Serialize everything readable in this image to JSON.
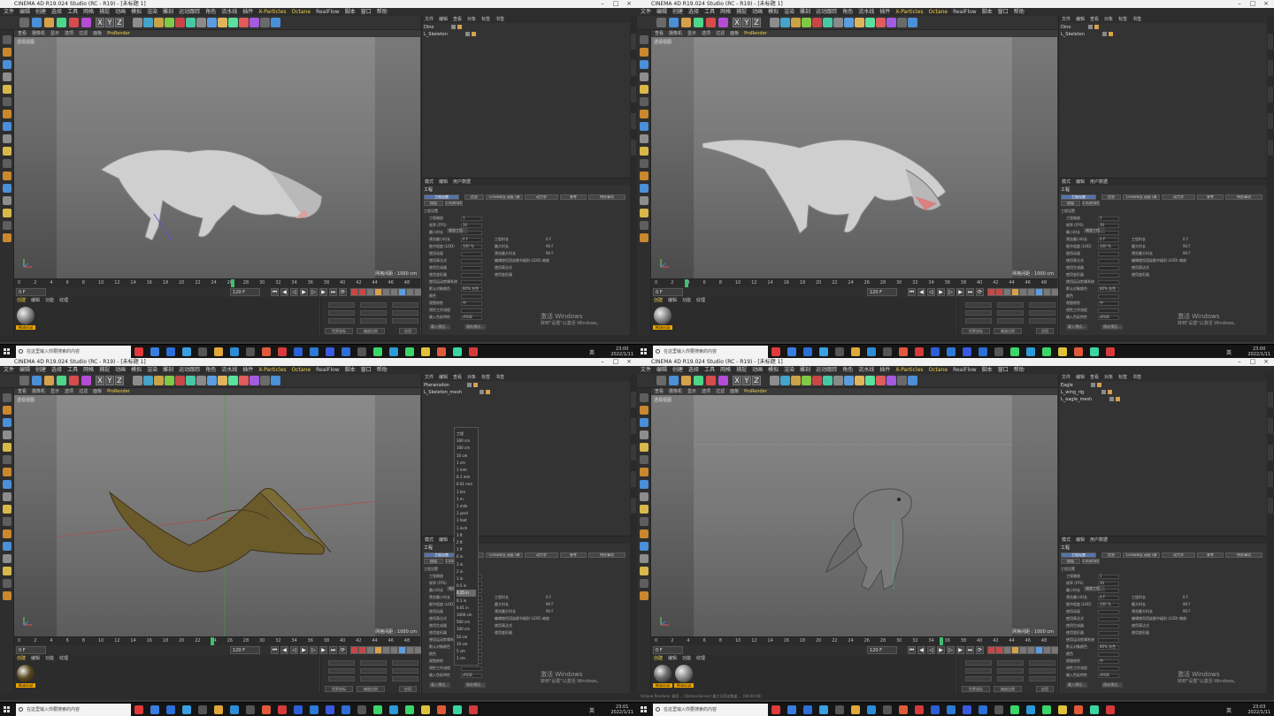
{
  "app": {
    "title": "CINEMA 4D R19.024 Studio (RC - R19) - [未标题 1]",
    "menu": [
      "文件",
      "编辑",
      "创建",
      "选择",
      "工具",
      "网格",
      "捕捉",
      "动画",
      "模拟",
      "渲染",
      "雕刻",
      "运动跟踪",
      "角色",
      "流水线",
      "插件",
      "X-Particles",
      "Octane",
      "RealFlow",
      "脚本",
      "窗口",
      "帮助"
    ],
    "layout_label": "界面:",
    "layout_value": "启动"
  },
  "viewport": {
    "menu": [
      "查看",
      "摄像机",
      "显示",
      "选项",
      "过滤",
      "面板",
      "ProRender"
    ],
    "camera_label": "透视视图",
    "grid_label": "网格间距 : 1000 cm"
  },
  "timeline": {
    "ticks": [
      "0",
      "2",
      "4",
      "6",
      "8",
      "10",
      "12",
      "14",
      "16",
      "18",
      "20",
      "22",
      "24",
      "26",
      "28",
      "30",
      "32",
      "34",
      "36",
      "38",
      "40",
      "42",
      "44",
      "46",
      "48"
    ],
    "start_field": "0 F",
    "end_field": "120 F",
    "frame_field": "0 F"
  },
  "material_panel": {
    "menu": [
      "创建",
      "编辑",
      "功能",
      "纹理"
    ],
    "material_name": "Material"
  },
  "coords_panel": {
    "buttons": [
      "世界坐标",
      "缩放比例",
      "应用"
    ]
  },
  "object_manager": {
    "menu": [
      "文件",
      "编辑",
      "查看",
      "对象",
      "标签",
      "书签"
    ],
    "quads": [
      {
        "rows": [
          "Dino",
          "L_Skeleton"
        ]
      },
      {
        "rows": [
          "Dino",
          "L_Skeleton"
        ]
      },
      {
        "rows": [
          "Pteranodon",
          "L_Skeleton_mesh"
        ]
      },
      {
        "rows": [
          "Eagle",
          "L_wing_rig",
          "L_eagle_mesh"
        ]
      }
    ]
  },
  "attribute_manager": {
    "menu": [
      "模式",
      "编辑",
      "用户数据"
    ],
    "title": "工程",
    "tabs": [
      "工程设置",
      "信息",
      "Cineware 动画 (调用)",
      "动力学",
      "参考",
      "待办事项",
      "插值",
      "Cinema4D 传出"
    ],
    "section": "工程设置",
    "rows": [
      {
        "label": "工程缩放",
        "value": "1"
      },
      {
        "label": "帧率 (FPS)",
        "value": "30"
      },
      {
        "label": "最小时长",
        "value": "0 F"
      },
      {
        "label": "预览最小时长",
        "value": "0 F"
      },
      {
        "label": "细节程度 (LOD)",
        "value": "100 %"
      },
      {
        "label": "使用动画",
        "value": ""
      },
      {
        "label": "使用表达式",
        "value": ""
      },
      {
        "label": "使用生成器",
        "value": ""
      },
      {
        "label": "使用变形器",
        "value": ""
      },
      {
        "label": "使用运动剪辑系统",
        "value": ""
      },
      {
        "label": "默认对象颜色",
        "value": "80% 灰色"
      },
      {
        "label": "颜色",
        "value": ""
      },
      {
        "label": "视图修剪",
        "value": "中"
      },
      {
        "label": "线性工作流程",
        "value": ""
      },
      {
        "label": "输入色彩特性",
        "value": "sRGB"
      }
    ],
    "right_rows": [
      {
        "label": "工程时长",
        "value": "0 F"
      },
      {
        "label": "最大时长",
        "value": "90 F"
      },
      {
        "label": "预览最大时长",
        "value": "90 F"
      },
      {
        "label": "编辑使用渲染细节级别 (LOD) 缩放",
        "value": ""
      },
      {
        "label": "使用表达式",
        "value": ""
      },
      {
        "label": "使用变形器",
        "value": ""
      }
    ],
    "buttons": [
      "缩放工程...",
      "载入预设...",
      "保存预设..."
    ]
  },
  "watermark": {
    "line1": "激活 Windows",
    "line2": "转到\"设置\"以激活 Windows。"
  },
  "taskbar": {
    "search_placeholder": "在这里输入你要搜索的内容",
    "ime": "英",
    "clock": [
      {
        "time": "23:00",
        "date": "2022/1/11"
      },
      {
        "time": "23:00",
        "date": "2022/1/11"
      },
      {
        "time": "23:01",
        "date": "2022/1/11"
      },
      {
        "time": "23:03",
        "date": "2022/1/11"
      }
    ]
  },
  "status": {
    "text": "Octane Renderer 调用 ... [OctaneServer] 最大可用化数量 ... (00:00:00)"
  },
  "dropdown": {
    "items": [
      "工程",
      "300 cm",
      "100 cm",
      "10 cm",
      "1 cm",
      "1 mm",
      "0.1 mm",
      "0.01 mm",
      "1 km",
      "1 m",
      "1 mile",
      "1 yard",
      "1 foot",
      "1 inch",
      "3 ft",
      "2 ft",
      "1 ft",
      "6 in",
      "3 in",
      "2 in",
      "1 in",
      "0.5 in",
      "0.25 in",
      "0.1 in",
      "0.01 in",
      "1000 cm",
      "500 cm",
      "100 cm",
      "50 cm",
      "10 cm",
      "5 cm",
      "1 cm"
    ],
    "selected_index": 22
  },
  "colors": {
    "accent": "#f3d14a",
    "selection": "#5575a8",
    "material": "#e8a200",
    "timeline_cursor": "#3fbf70"
  }
}
